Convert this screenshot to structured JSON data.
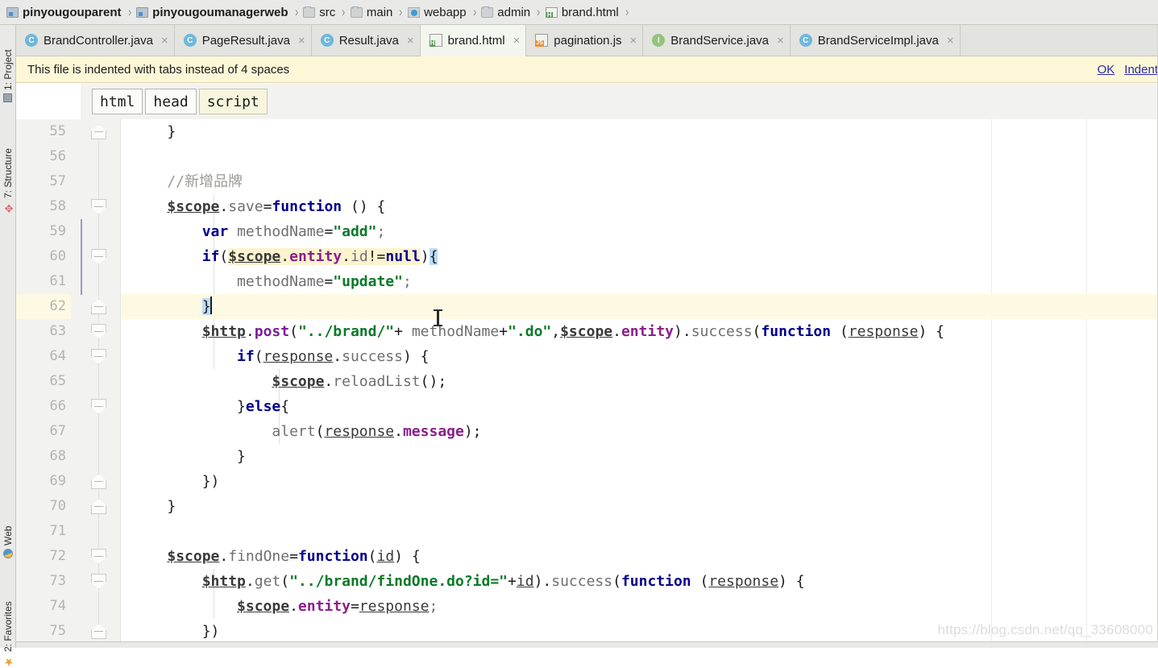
{
  "window": {
    "app": "IntelliJ IDEA",
    "watermark": "https://blog.csdn.net/qq_33608000"
  },
  "navbar": {
    "items": [
      {
        "label": "pinyougouparent",
        "icon": "module-icon",
        "bold": true,
        "sep": "›"
      },
      {
        "label": "pinyougoumanagerweb",
        "icon": "module-icon",
        "bold": true,
        "sep": "›"
      },
      {
        "label": "src",
        "icon": "folder-icon",
        "bold": false,
        "sep": "›"
      },
      {
        "label": "main",
        "icon": "folder-icon",
        "bold": false,
        "sep": "›"
      },
      {
        "label": "webapp",
        "icon": "web-folder-icon",
        "bold": false,
        "sep": "›"
      },
      {
        "label": "admin",
        "icon": "folder-icon",
        "bold": false,
        "sep": "›"
      },
      {
        "label": "brand.html",
        "icon": "html-file-icon",
        "bold": false,
        "sep": "›"
      }
    ]
  },
  "tabs": [
    {
      "label": "BrandController.java",
      "icon": "java-class-icon",
      "active": false,
      "close": "×"
    },
    {
      "label": "PageResult.java",
      "icon": "java-class-icon",
      "active": false,
      "close": "×"
    },
    {
      "label": "Result.java",
      "icon": "java-class-icon",
      "active": false,
      "close": "×"
    },
    {
      "label": "brand.html",
      "icon": "html-file-icon",
      "active": true,
      "close": "×"
    },
    {
      "label": "pagination.js",
      "icon": "js-file-icon",
      "active": false,
      "close": "×"
    },
    {
      "label": "BrandService.java",
      "icon": "java-interface-icon",
      "active": false,
      "close": "×"
    },
    {
      "label": "BrandServiceImpl.java",
      "icon": "java-class-icon",
      "active": false,
      "close": "×"
    }
  ],
  "notification": {
    "message": "This file is indented with tabs instead of 4 spaces",
    "actions": [
      {
        "label": "OK"
      },
      {
        "label": "Indent"
      }
    ],
    "background": "#fdf7d8"
  },
  "structure_chips": [
    {
      "label": "html",
      "active": false
    },
    {
      "label": "head",
      "active": false
    },
    {
      "label": "script",
      "active": true
    }
  ],
  "tool_windows": {
    "left": [
      {
        "label": "1: Project",
        "icon": "project-icon"
      },
      {
        "label": "7: Structure",
        "icon": "structure-icon"
      },
      {
        "label": "Web",
        "icon": "web-icon"
      },
      {
        "label": "2: Favorites",
        "icon": "star-icon"
      }
    ]
  },
  "editor": {
    "file": "brand.html",
    "first_line": 55,
    "highlighted_line": 62,
    "lines": [
      {
        "n": 55,
        "fold": "close",
        "text": "    }"
      },
      {
        "n": 56,
        "fold": null,
        "text": ""
      },
      {
        "n": 57,
        "fold": null,
        "text": "    //新增品牌"
      },
      {
        "n": 58,
        "fold": "open",
        "text": "    $scope.save=function () {"
      },
      {
        "n": 59,
        "fold": null,
        "text": "        var methodName=\"add\";"
      },
      {
        "n": 60,
        "fold": "open",
        "text": "        if($scope.entity.id!=null){"
      },
      {
        "n": 61,
        "fold": null,
        "text": "            methodName=\"update\";"
      },
      {
        "n": 62,
        "fold": "close",
        "text": "        }"
      },
      {
        "n": 63,
        "fold": "open",
        "text": "        $http.post(\"../brand/\"+ methodName+\".do\",$scope.entity).success(function (response) {"
      },
      {
        "n": 64,
        "fold": "open",
        "text": "            if(response.success){"
      },
      {
        "n": 65,
        "fold": null,
        "text": "                $scope.reloadList();"
      },
      {
        "n": 66,
        "fold": "open",
        "text": "            }else{"
      },
      {
        "n": 67,
        "fold": null,
        "text": "                alert(response.message);"
      },
      {
        "n": 68,
        "fold": null,
        "text": "            }"
      },
      {
        "n": 69,
        "fold": "close",
        "text": "        })"
      },
      {
        "n": 70,
        "fold": "close",
        "text": "    }"
      },
      {
        "n": 71,
        "fold": null,
        "text": ""
      },
      {
        "n": 72,
        "fold": "open",
        "text": "    $scope.findOne=function(id){"
      },
      {
        "n": 73,
        "fold": "open",
        "text": "        $http.get(\"../brand/findOne.do?id=\"+id).success(function (response) {"
      },
      {
        "n": 74,
        "fold": null,
        "text": "            $scope.entity=response;"
      },
      {
        "n": 75,
        "fold": "close",
        "text": "        })"
      }
    ]
  }
}
